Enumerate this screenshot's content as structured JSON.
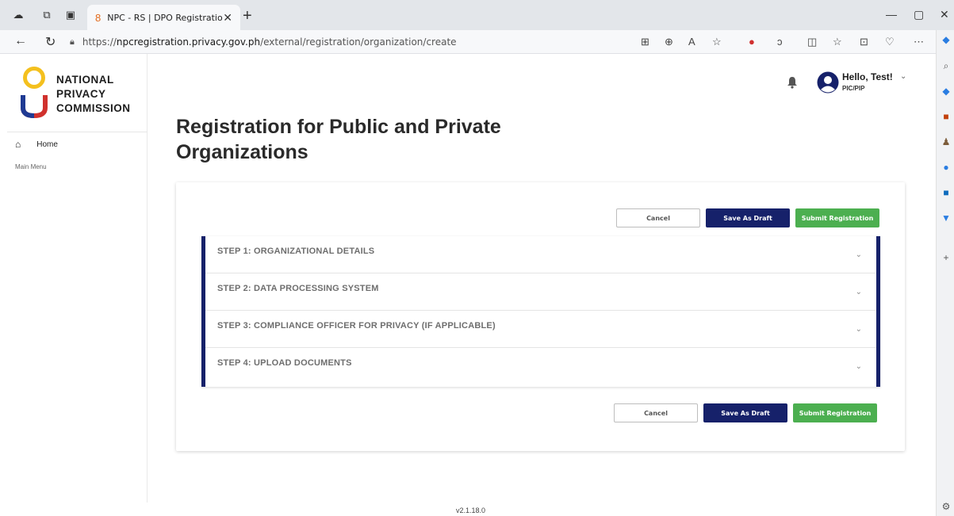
{
  "browser": {
    "tab_title": "NPC - RS | DPO Registration",
    "url_prefix": "https://",
    "url_host": "npcregistration.privacy.gov.ph",
    "url_path": "/external/registration/organization/create"
  },
  "sidebar": {
    "logo_line1": "NATIONAL",
    "logo_line2": "PRIVACY",
    "logo_line3": "COMMISSION",
    "home_label": "Home",
    "main_menu_label": "Main Menu"
  },
  "header": {
    "greeting": "Hello, Test!",
    "role": "PIC/PIP"
  },
  "main": {
    "title_line1": "Registration for Public and Private",
    "title_line2": "Organizations",
    "cancel_label": "Cancel",
    "save_draft_label": "Save As Draft",
    "submit_label": "Submit Registration",
    "steps": [
      {
        "label": "STEP 1: ORGANIZATIONAL DETAILS"
      },
      {
        "label": "STEP 2: DATA PROCESSING SYSTEM"
      },
      {
        "label": "STEP 3: COMPLIANCE OFFICER FOR PRIVACY (IF APPLICABLE)"
      },
      {
        "label": "STEP 4: UPLOAD DOCUMENTS"
      }
    ]
  },
  "footer": {
    "version": "v2.1.18.0"
  },
  "colors": {
    "primary_navy": "#16216a",
    "submit_green": "#4caf50",
    "logo_yellow": "#f4c01e"
  }
}
